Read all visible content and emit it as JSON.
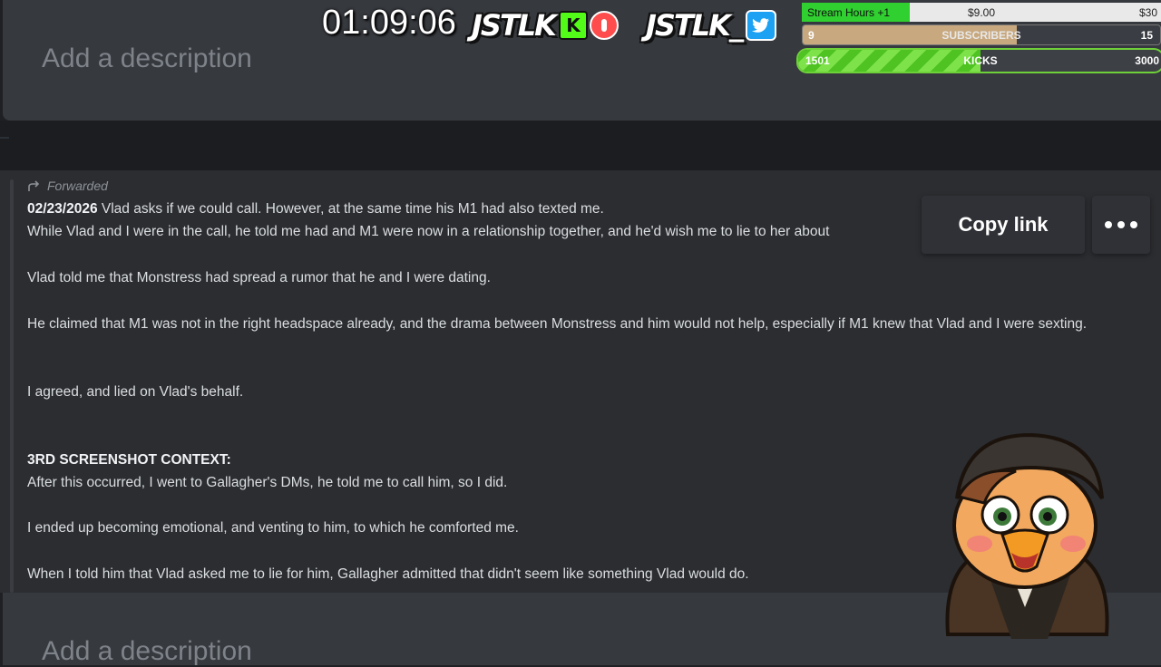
{
  "top_panel": {
    "placeholder": "Add a description"
  },
  "bottom_panel": {
    "placeholder": "Add a description"
  },
  "message": {
    "forwarded_label": "Forwarded",
    "date": "02/23/2026",
    "line1_rest": " Vlad asks if we could call. However, at the same time his M1 had also texted me.",
    "line2": "While Vlad and I were in the call, he told me had and M1 were now in a relationship together, and he'd wish me to lie to her about",
    "line3": "Vlad told me that Monstress had spread a rumor that he and I were dating.",
    "line4": "He claimed that M1 was not in the right headspace already, and the drama between Monstress and him would not help, especially if M1 knew that Vlad and I were sexting.",
    "line5": "I agreed, and lied on Vlad's behalf.",
    "heading": "3RD SCREENSHOT CONTEXT:",
    "line6": "After this occurred, I went to Gallagher's DMs, he told me to call him, so I did.",
    "line7": "I ended up becoming emotional, and venting to him, to which he comforted me.",
    "line8": "When I told him that Vlad asked me to lie for him, Gallagher admitted that didn't seem like something Vlad would do."
  },
  "actions": {
    "copy_link": "Copy link"
  },
  "overlay": {
    "timer": "01:09:06",
    "brand1": "JSTLK",
    "brand2": "JSTLK_",
    "kick_letter": "K",
    "stats": {
      "hours_label": "Stream Hours +1",
      "hours_mid": "$9.00",
      "hours_max": "$30",
      "hours_progress": 0.3,
      "subs_current": "9",
      "subs_label": "SUBSCRIBERS",
      "subs_max": "15",
      "subs_progress": 0.6,
      "kicks_current": "1501",
      "kicks_label": "KICKS",
      "kicks_max": "3000",
      "kicks_progress": 0.5
    }
  },
  "colors": {
    "accent_green": "#53fc18",
    "twitter_blue": "#1da1f2",
    "panel": "#36393e",
    "message_bg": "#2b2d31"
  },
  "icons": [
    "forward-arrow-icon",
    "more-options-icon",
    "kick-icon",
    "live-icon",
    "twitter-icon"
  ]
}
